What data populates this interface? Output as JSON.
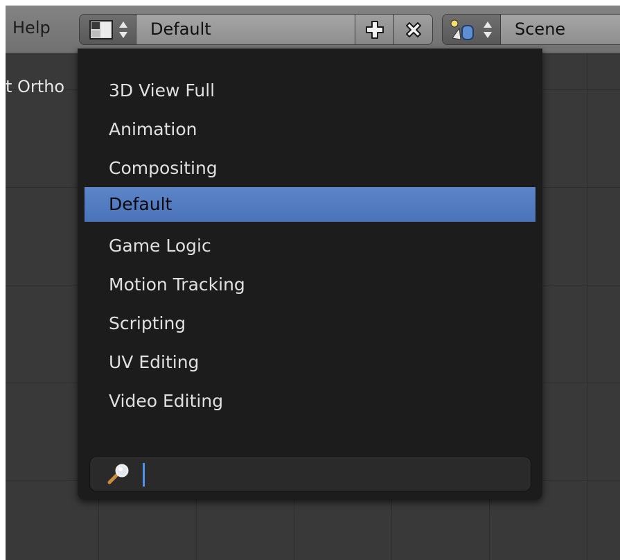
{
  "header": {
    "menu_help": "Help",
    "layout_name": "Default",
    "scene_name": "Scene"
  },
  "viewport": {
    "label": "t Ortho"
  },
  "layout_menu": {
    "items": [
      "3D View Full",
      "Animation",
      "Compositing",
      "Default",
      "Game Logic",
      "Motion Tracking",
      "Scripting",
      "UV Editing",
      "Video Editing"
    ],
    "selected": "Default",
    "search_value": ""
  },
  "icons": [
    "screen-layout-icon",
    "updown-arrows-icon",
    "plus-icon",
    "close-icon",
    "scene-icon",
    "search-icon"
  ],
  "colors": {
    "header": "#7d7d7d",
    "viewport": "#393939",
    "menu_bg": "#1c1c1c",
    "selection": "#5680c4",
    "text_cursor": "#4d94f0"
  }
}
